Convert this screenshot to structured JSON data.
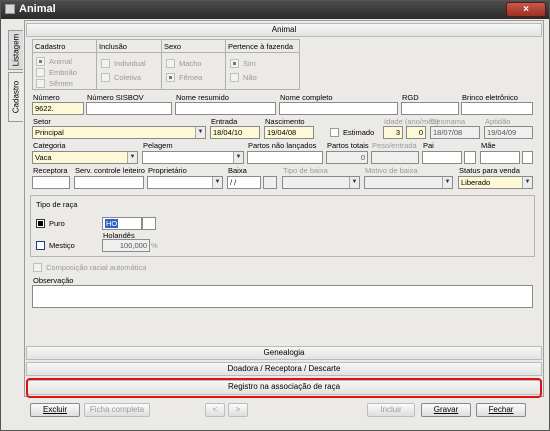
{
  "window": {
    "title": "Animal",
    "close_label": "×"
  },
  "side_tabs": {
    "listagem": "Listagem",
    "cadastro": "Cadastro"
  },
  "section_header": "Animal",
  "grid_groups": {
    "cadastro": {
      "title": "Cadastro",
      "options": [
        "Animal",
        "Embrião",
        "Sêmen"
      ]
    },
    "inclusao": {
      "title": "Inclusão",
      "options": [
        "Individual",
        "Coletiva"
      ]
    },
    "sexo": {
      "title": "Sexo",
      "options": [
        "Macho",
        "Fêmea"
      ]
    },
    "pertence": {
      "title": "Pertence à fazenda",
      "options": [
        "Sim",
        "Não"
      ]
    }
  },
  "row1": {
    "numero_label": "Número",
    "numero_value": "9622.",
    "sisbov_label": "Número SISBOV",
    "sisbov_value": "",
    "nome_resumido_label": "Nome resumido",
    "nome_resumido_value": "",
    "nome_completo_label": "Nome completo",
    "nome_completo_value": "",
    "rgd_label": "RGD",
    "rgd_value": "",
    "brinco_label": "Brinco eletrônico",
    "brinco_value": ""
  },
  "row2": {
    "setor_label": "Setor",
    "setor_value": "Principal",
    "entrada_label": "Entrada",
    "entrada_value": "18/04/10",
    "nascimento_label": "Nascimento",
    "nascimento_value": "19/04/08",
    "estimado_label": "Estimado",
    "idade_label": "Idade (ano/mês)",
    "idade_ano": "3",
    "idade_mes": "0",
    "desmama_label": "Desmama",
    "desmama_value": "18/07/08",
    "aptidao_label": "Aptidão",
    "aptidao_value": "19/04/09"
  },
  "row3": {
    "categoria_label": "Categoria",
    "categoria_value": "Vaca",
    "pelagem_label": "Pelagem",
    "pelagem_value": "",
    "partos_nao_label": "Partos não lançados",
    "partos_nao_value": "",
    "partos_totais_label": "Partos totais",
    "partos_totais_value": "0",
    "peso_entrada_label": "Peso/entrada",
    "peso_entrada_value": "",
    "pai_label": "Pai",
    "pai_value": "",
    "mae_label": "Mãe",
    "mae_value": ""
  },
  "row4": {
    "receptora_label": "Receptora",
    "receptora_value": "",
    "serv_label": "Serv. controle leiteiro",
    "serv_value": "",
    "proprietario_label": "Proprietário",
    "proprietario_value": "",
    "baixa_label": "Baixa",
    "baixa_value": " / /",
    "tipo_baixa_label": "Tipo de baixa",
    "tipo_baixa_value": "",
    "motivo_baixa_label": "Motivo de baixa",
    "motivo_baixa_value": "",
    "status_label": "Status para venda",
    "status_value": "Liberado"
  },
  "tipo_raca": {
    "title": "Tipo de raça",
    "puro_label": "Puro",
    "puro_code": "HO",
    "mestico_label": "Mestiço",
    "holandes_label": "Holandês",
    "holandes_value": "100,000",
    "percent": "%"
  },
  "composicao_label": "Composição racial automática",
  "observacao_label": "Observação",
  "sections": {
    "genealogia": "Genealogia",
    "doadora": "Doadora / Receptora / Descarte",
    "registro": "Registro na associação de raça"
  },
  "buttons": {
    "excluir": "Excluir",
    "ficha": "Ficha completa",
    "prev": "<",
    "next": ">",
    "incluir": "Incluir",
    "gravar": "Gravar",
    "fechar": "Fechar"
  }
}
